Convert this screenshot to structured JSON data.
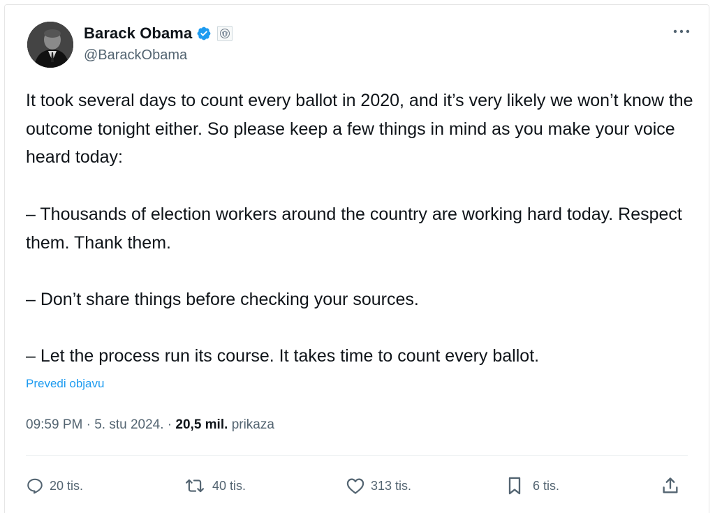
{
  "author": {
    "display_name": "Barack Obama",
    "handle": "@BarackObama",
    "verified_icon": "verified-badge-icon",
    "affiliation_icon": "government-seal-icon"
  },
  "post": {
    "paragraphs": [
      "It took several days to count every ballot in 2020, and it’s very likely we won’t know the outcome tonight either. So please keep a few things in mind as you make your voice heard today:",
      "– Thousands of election workers around the country are working hard today. Respect them. Thank them.",
      "– Don’t share things before checking your sources.",
      "– Let the process run its course. It takes time to count every ballot."
    ],
    "translate_label": "Prevedi objavu",
    "time": "09:59 PM",
    "date": "5. stu 2024.",
    "views_count": "20,5 mil.",
    "views_label": "prikaza"
  },
  "actions": {
    "replies": "20 tis.",
    "reposts": "40 tis.",
    "likes": "313 tis.",
    "bookmarks": "6 tis."
  },
  "colors": {
    "accent": "#1d9bf0",
    "text": "#0f1419",
    "muted": "#536471"
  }
}
